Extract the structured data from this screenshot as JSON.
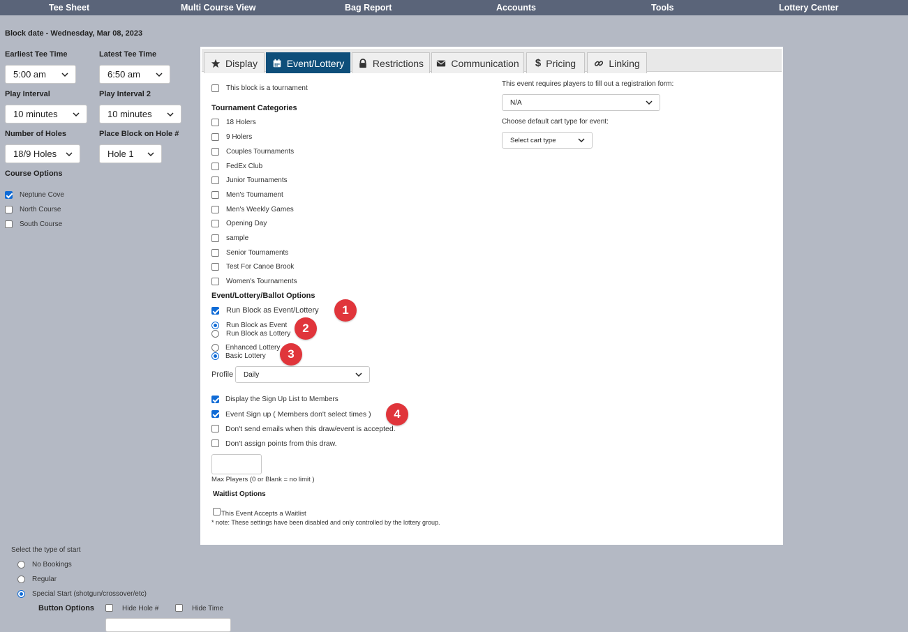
{
  "nav": [
    "Tee Sheet",
    "Multi Course View",
    "Bag Report",
    "Accounts",
    "Tools",
    "Lottery Center"
  ],
  "block_date": "Block date - Wednesday, Mar 08, 2023",
  "left": {
    "earliest_label": "Earliest Tee Time",
    "earliest_value": "5:00 am",
    "latest_label": "Latest Tee Time",
    "latest_value": "6:50 am",
    "interval_label": "Play Interval",
    "interval_value": "10 minutes",
    "interval2_label": "Play Interval 2",
    "interval2_value": "10 minutes",
    "holes_label": "Number of Holes",
    "holes_value": "18/9 Holes",
    "place_label": "Place Block on Hole #",
    "place_value": "Hole 1",
    "course_options_label": "Course Options",
    "courses": [
      {
        "label": "Neptune Cove",
        "checked": true
      },
      {
        "label": "North Course",
        "checked": false
      },
      {
        "label": "South Course",
        "checked": false
      }
    ]
  },
  "start": {
    "label": "Select the type of start",
    "options": [
      {
        "label": "No Bookings",
        "checked": false
      },
      {
        "label": "Regular",
        "checked": false
      },
      {
        "label": "Special Start (shotgun/crossover/etc)",
        "checked": true
      }
    ],
    "button_options_label": "Button Options",
    "hide_hole": "Hide Hole #",
    "hide_time": "Hide Time"
  },
  "tabs": [
    {
      "label": "Display",
      "icon": "star-icon",
      "active": false
    },
    {
      "label": "Event/Lottery",
      "icon": "calendar-icon",
      "active": true
    },
    {
      "label": "Restrictions",
      "icon": "lock-icon",
      "active": false
    },
    {
      "label": "Communication",
      "icon": "envelope-icon",
      "active": false
    },
    {
      "label": "Pricing",
      "icon": "dollar-icon",
      "active": false
    },
    {
      "label": "Linking",
      "icon": "link-icon",
      "active": false
    }
  ],
  "panel": {
    "tournament_label": "This block is a tournament",
    "categories_title": "Tournament Categories",
    "categories": [
      "18 Holers",
      "9 Holers",
      "Couples Tournaments",
      "FedEx Club",
      "Junior Tournaments",
      "Men's Tournament",
      "Men's Weekly Games",
      "Opening Day",
      "sample",
      "Senior Tournaments",
      "Test For Canoe Brook",
      "Women's Tournaments"
    ],
    "ballot_title": "Event/Lottery/Ballot Options",
    "run_block": "Run Block as Event/Lottery",
    "run_event": "Run Block as Event",
    "run_lottery": "Run Block as Lottery",
    "enhanced_lottery": "Enhanced Lottery",
    "basic_lottery": "Basic Lottery",
    "profile_label": "Profile",
    "profile_value": "Daily",
    "display_signup": "Display the Sign Up List to Members",
    "event_signup": "Event Sign up ( Members don't select times )",
    "dont_send": "Don't send emails when this draw/event is accepted.",
    "dont_assign": "Don't assign points from this draw.",
    "max_players": "Max Players (0 or Blank = no limit )",
    "waitlist_title": "Waitlist Options",
    "waitlist_accepts": "This Event Accepts a Waitlist",
    "waitlist_note": "* note: These settings have been disabled and only controlled by the lottery group.",
    "reg_form_label": "This event requires players to fill out a registration form:",
    "reg_form_value": "N/A",
    "cart_label": "Choose default cart type for event:",
    "cart_value": "Select cart type"
  },
  "badges": [
    "1",
    "2",
    "3",
    "4"
  ],
  "colors": {
    "nav_bg": "#5a6479",
    "page_bg": "#b4b9c4",
    "tab_active": "#0e4e7a",
    "badge": "#e0353b",
    "check": "#0f6bd6"
  }
}
